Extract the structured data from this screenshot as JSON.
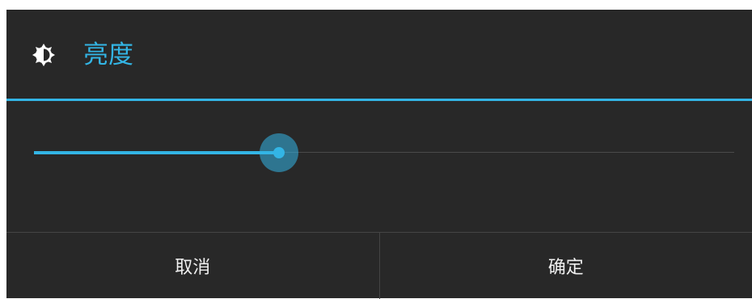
{
  "dialog": {
    "title": "亮度",
    "title_icon": "brightness-icon",
    "accent_color": "#33b5e5",
    "background_color": "#282828"
  },
  "slider": {
    "value_fraction": 0.35
  },
  "buttons": {
    "cancel_label": "取消",
    "ok_label": "确定"
  }
}
